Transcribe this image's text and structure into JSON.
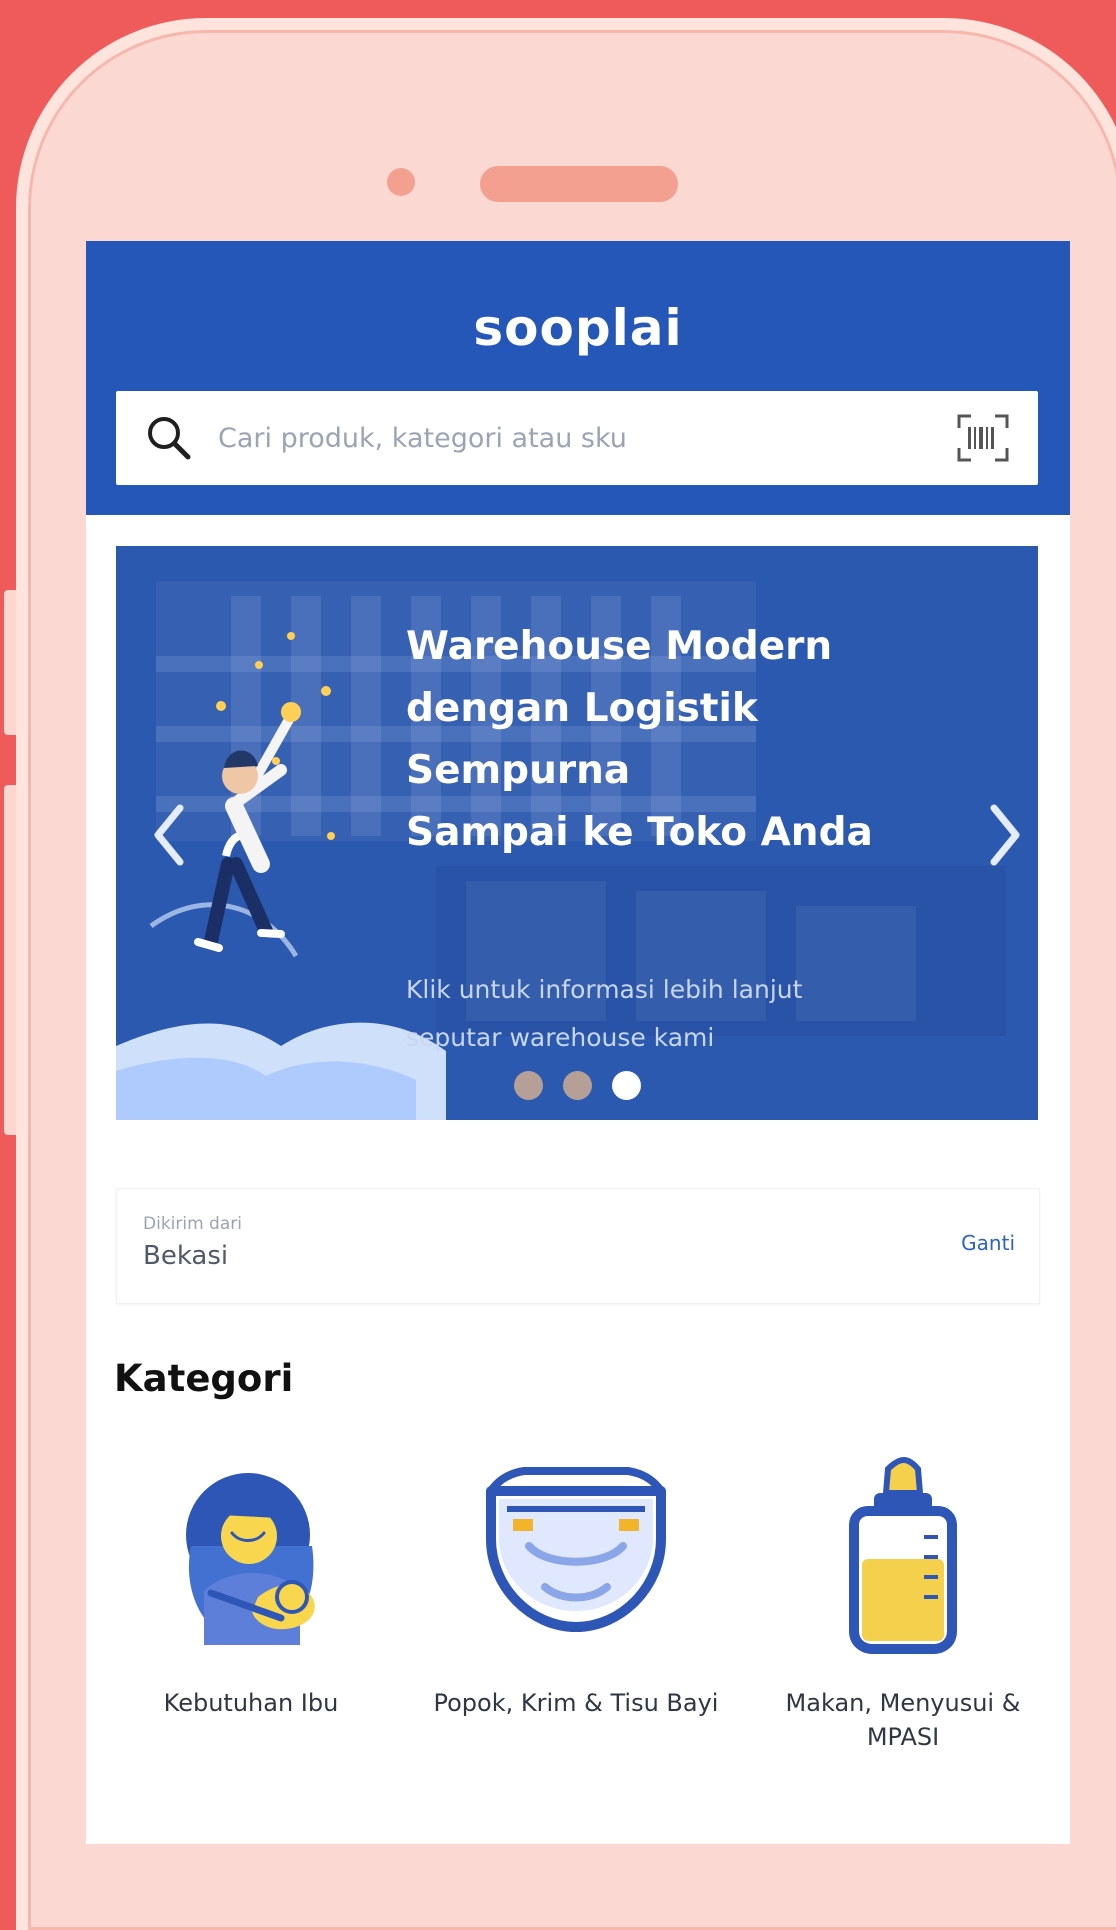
{
  "header": {
    "brand": "sooplai"
  },
  "search": {
    "placeholder": "Cari produk, kategori atau sku"
  },
  "banner": {
    "title_line1": "Warehouse Modern",
    "title_line2": "dengan Logistik Sempurna",
    "title_line3": "Sampai ke Toko Anda",
    "subtitle_line1": "Klik untuk informasi lebih lanjut",
    "subtitle_line2": "seputar warehouse kami"
  },
  "delivery": {
    "label": "Dikirim dari",
    "city": "Bekasi",
    "action": "Ganti"
  },
  "section": {
    "title": "Kategori"
  },
  "categories": [
    {
      "label": "Kebutuhan Ibu"
    },
    {
      "label": "Popok, Krim & Tisu Bayi"
    },
    {
      "label": "Makan, Menyusui & MPASI"
    }
  ],
  "colors": {
    "page_background": "#ef5a5a",
    "phone_shell": "#fbd8d1",
    "brand_blue": "#2457b7",
    "banner_blue": "#2a5ab8",
    "white": "#ffffff",
    "soft_pink": "#f3a091"
  },
  "icons": {
    "search": "search-icon",
    "barcode": "barcode-icon",
    "prev": "chevron-left-icon",
    "next": "chevron-right-icon"
  }
}
